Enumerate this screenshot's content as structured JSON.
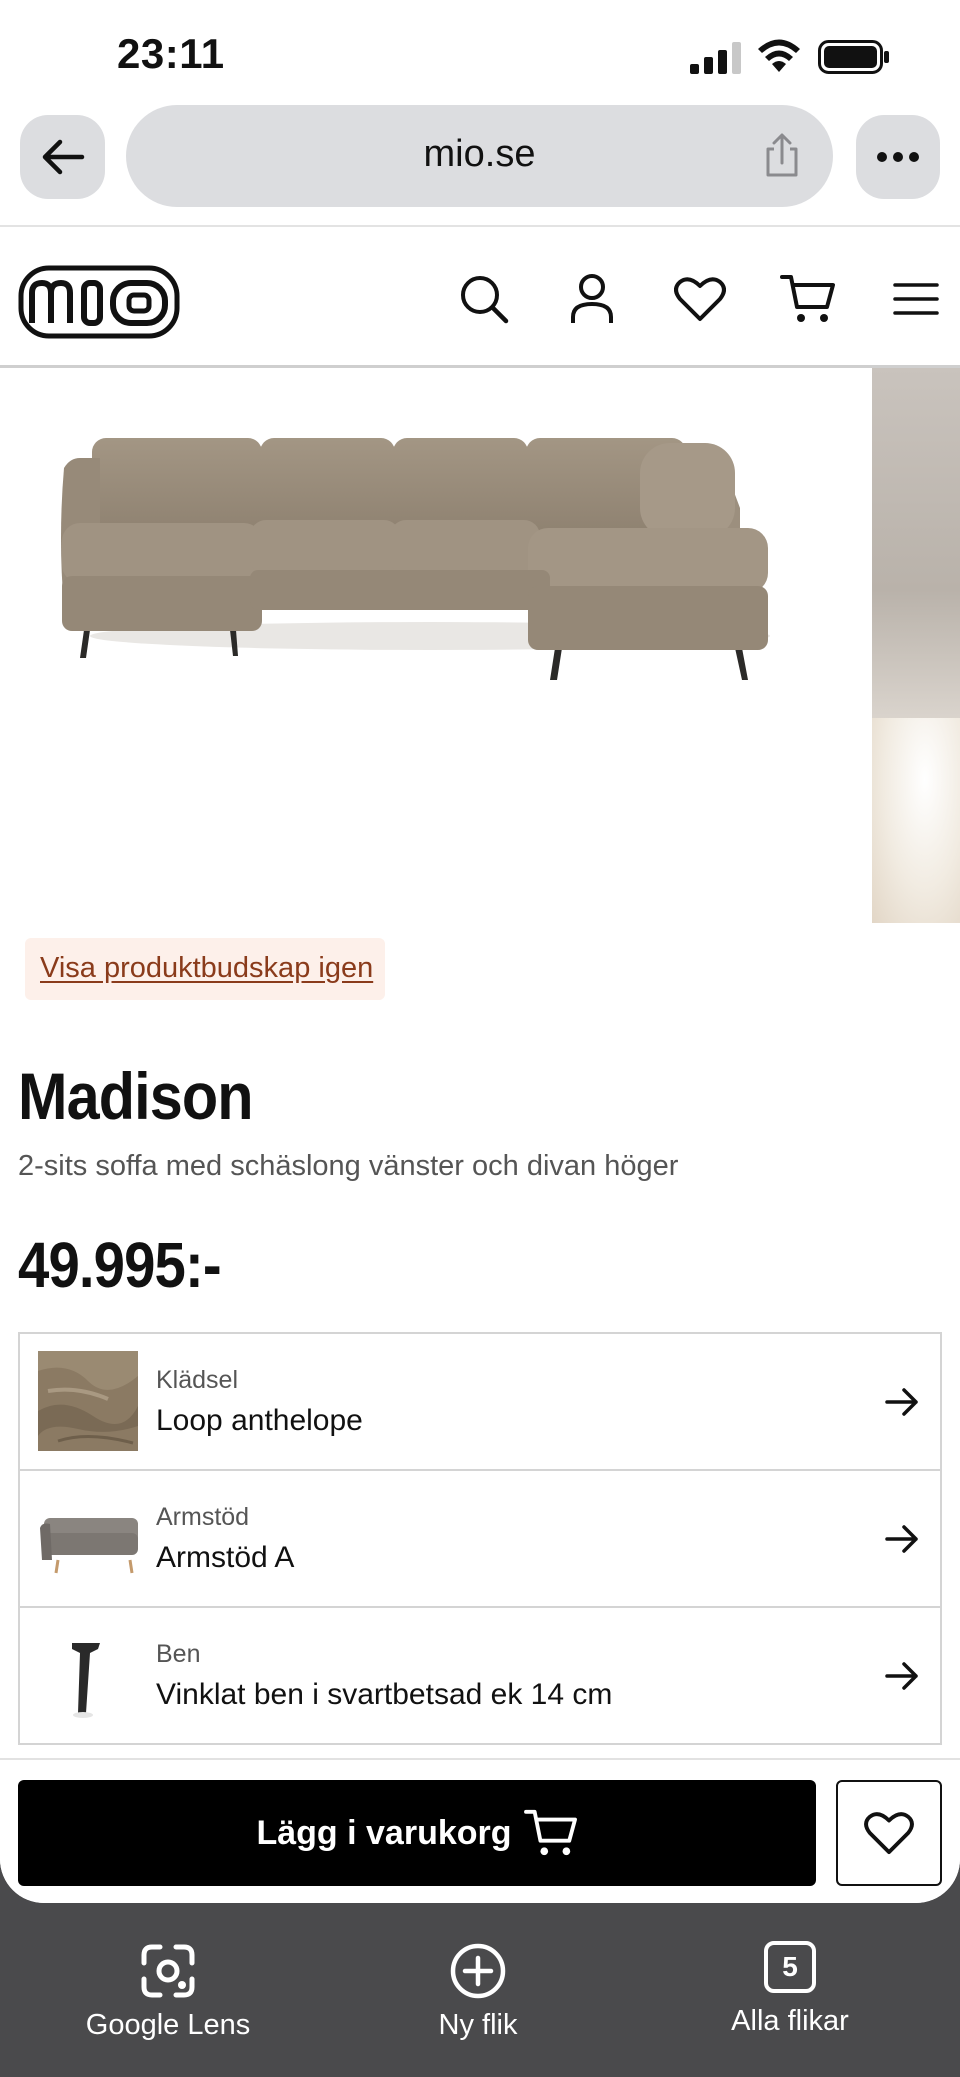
{
  "status_bar": {
    "time": "23:11"
  },
  "browser": {
    "url": "mio.se"
  },
  "site": {
    "logo_text": "mio"
  },
  "product": {
    "notice_link": "Visa produktbudskap igen",
    "title": "Madison",
    "subtitle": "2-sits soffa med schäslong vänster och divan höger",
    "price": "49.995:-"
  },
  "options": [
    {
      "label": "Klädsel",
      "value": "Loop anthelope",
      "thumb_icon": "fabric-swatch"
    },
    {
      "label": "Armstöd",
      "value": "Armstöd A",
      "thumb_icon": "armchair-thumb"
    },
    {
      "label": "Ben",
      "value": "Vinklat ben i svartbetsad ek 14 cm",
      "thumb_icon": "leg-thumb"
    }
  ],
  "cart": {
    "button_label": "Lägg i varukorg"
  },
  "toolbar": {
    "lens_label": "Google Lens",
    "new_tab_label": "Ny flik",
    "all_tabs_label": "Alla flikar",
    "tab_count": "5"
  },
  "colors": {
    "accent_notice_bg": "#fdf0ea",
    "notice_text": "#8a3b1b",
    "sofa": "#9a8d7d"
  }
}
